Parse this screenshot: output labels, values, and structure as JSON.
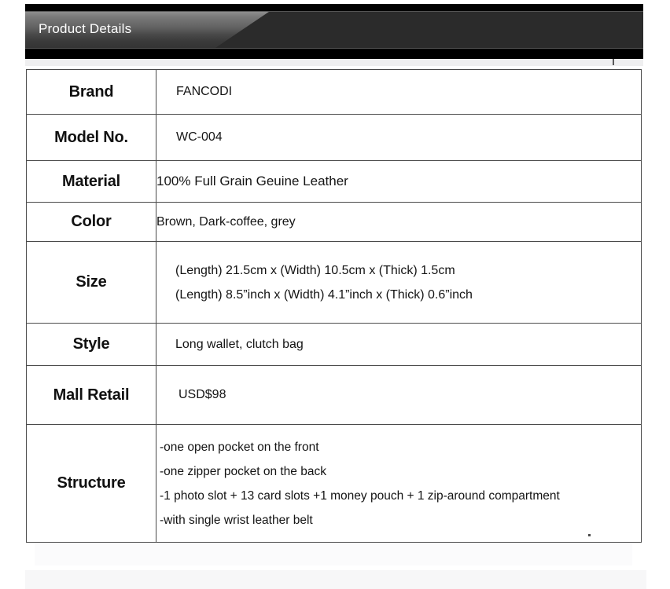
{
  "banner": {
    "tab_title": "Product Details"
  },
  "table": {
    "rows": [
      {
        "label": "Brand",
        "lines": [
          "FANCODI"
        ]
      },
      {
        "label": "Model No.",
        "lines": [
          "WC-004"
        ]
      },
      {
        "label": "Material",
        "lines": [
          "100% Full Grain  Geuine Leather"
        ]
      },
      {
        "label": "Color",
        "lines": [
          "Brown, Dark-coffee, grey"
        ]
      },
      {
        "label": "Size",
        "lines": [
          "(Length) 21.5cm x (Width) 10.5cm x (Thick) 1.5cm",
          "(Length) 8.5”inch x (Width) 4.1”inch x (Thick) 0.6”inch"
        ]
      },
      {
        "label": "Style",
        "lines": [
          "Long wallet, clutch bag"
        ]
      },
      {
        "label": "Mall Retail",
        "lines": [
          "USD$98"
        ]
      },
      {
        "label": "Structure",
        "lines": [
          "-one open pocket on the front",
          "-one zipper pocket on the back",
          "-1 photo slot + 13 card slots +1 money pouch + 1 zip-around compartment",
          "-with single wrist leather belt"
        ]
      }
    ]
  },
  "colors": {
    "banner_black": "#000000",
    "banner_gray": "#2b2b2b",
    "tab_light": "#8d8d8d",
    "tab_dark": "#343434",
    "border": "#4a4a4a",
    "text": "#141414",
    "title_text": "#ffffff"
  }
}
